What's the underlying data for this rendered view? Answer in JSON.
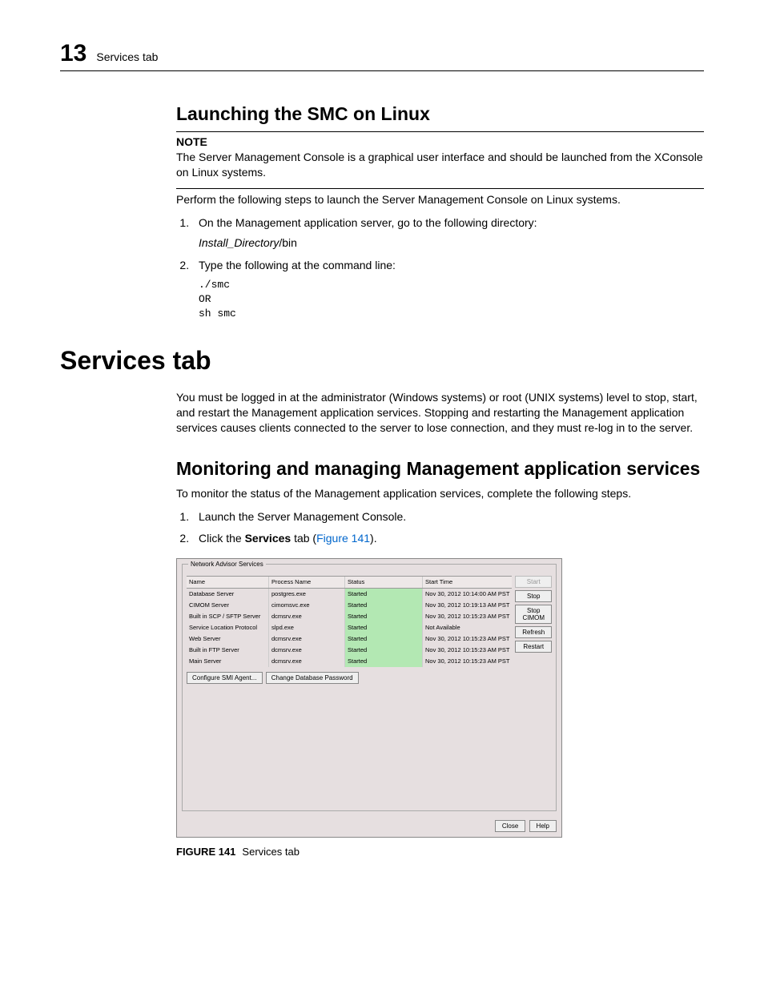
{
  "header": {
    "chapter_number": "13",
    "running_title": "Services tab"
  },
  "sec1": {
    "title": "Launching the SMC on Linux",
    "note_label": "NOTE",
    "note_text": "The Server Management Console is a graphical user interface and should be launched from the XConsole on Linux systems.",
    "intro": "Perform the following steps to launch the Server Management Console on Linux systems.",
    "step1": "On the Management application server, go to the following directory:",
    "step1_path_italic": "Install_Directory",
    "step1_path_rest": "/bin",
    "step2": "Type the following at the command line:",
    "code": "./smc\nOR\nsh smc"
  },
  "sec2": {
    "title": "Services tab",
    "para": "You must be logged in at the administrator (Windows systems) or root (UNIX systems) level to stop, start, and restart the Management application services. Stopping and restarting the Management application services causes clients connected to the server to lose connection, and they must re-log in to the server."
  },
  "sec3": {
    "title": "Monitoring and managing Management application services",
    "intro": "To monitor the status of the Management application services, complete the following steps.",
    "step1": "Launch the Server Management Console.",
    "step2_a": "Click the ",
    "step2_bold": "Services",
    "step2_b": " tab (",
    "step2_link": "Figure 141",
    "step2_c": ")."
  },
  "figure": {
    "group_title": "Network Advisor Services",
    "columns": {
      "name": "Name",
      "process": "Process Name",
      "status": "Status",
      "start": "Start Time"
    },
    "rows": [
      {
        "name": "Database Server",
        "proc": "postgres.exe",
        "status": "Started",
        "time": "Nov 30, 2012 10:14:00 AM PST"
      },
      {
        "name": "CIMOM Server",
        "proc": "cimomsvc.exe",
        "status": "Started",
        "time": "Nov 30, 2012 10:19:13 AM PST"
      },
      {
        "name": "Built in SCP / SFTP Server",
        "proc": "dcmsrv.exe",
        "status": "Started",
        "time": "Nov 30, 2012 10:15:23 AM PST"
      },
      {
        "name": "Service Location Protocol",
        "proc": "slpd.exe",
        "status": "Started",
        "time": "Not Available"
      },
      {
        "name": "Web Server",
        "proc": "dcmsrv.exe",
        "status": "Started",
        "time": "Nov 30, 2012 10:15:23 AM PST"
      },
      {
        "name": "Built in FTP Server",
        "proc": "dcmsrv.exe",
        "status": "Started",
        "time": "Nov 30, 2012 10:15:23 AM PST"
      },
      {
        "name": "Main Server",
        "proc": "dcmsrv.exe",
        "status": "Started",
        "time": "Nov 30, 2012 10:15:23 AM PST"
      }
    ],
    "buttons": {
      "start": "Start",
      "stop": "Stop",
      "stop_cimom": "Stop CIMOM",
      "refresh": "Refresh",
      "restart": "Restart",
      "config_smi": "Configure SMI Agent...",
      "change_pw": "Change Database Password",
      "close": "Close",
      "help": "Help"
    },
    "caption_label": "FIGURE 141",
    "caption_text": "Services tab"
  }
}
